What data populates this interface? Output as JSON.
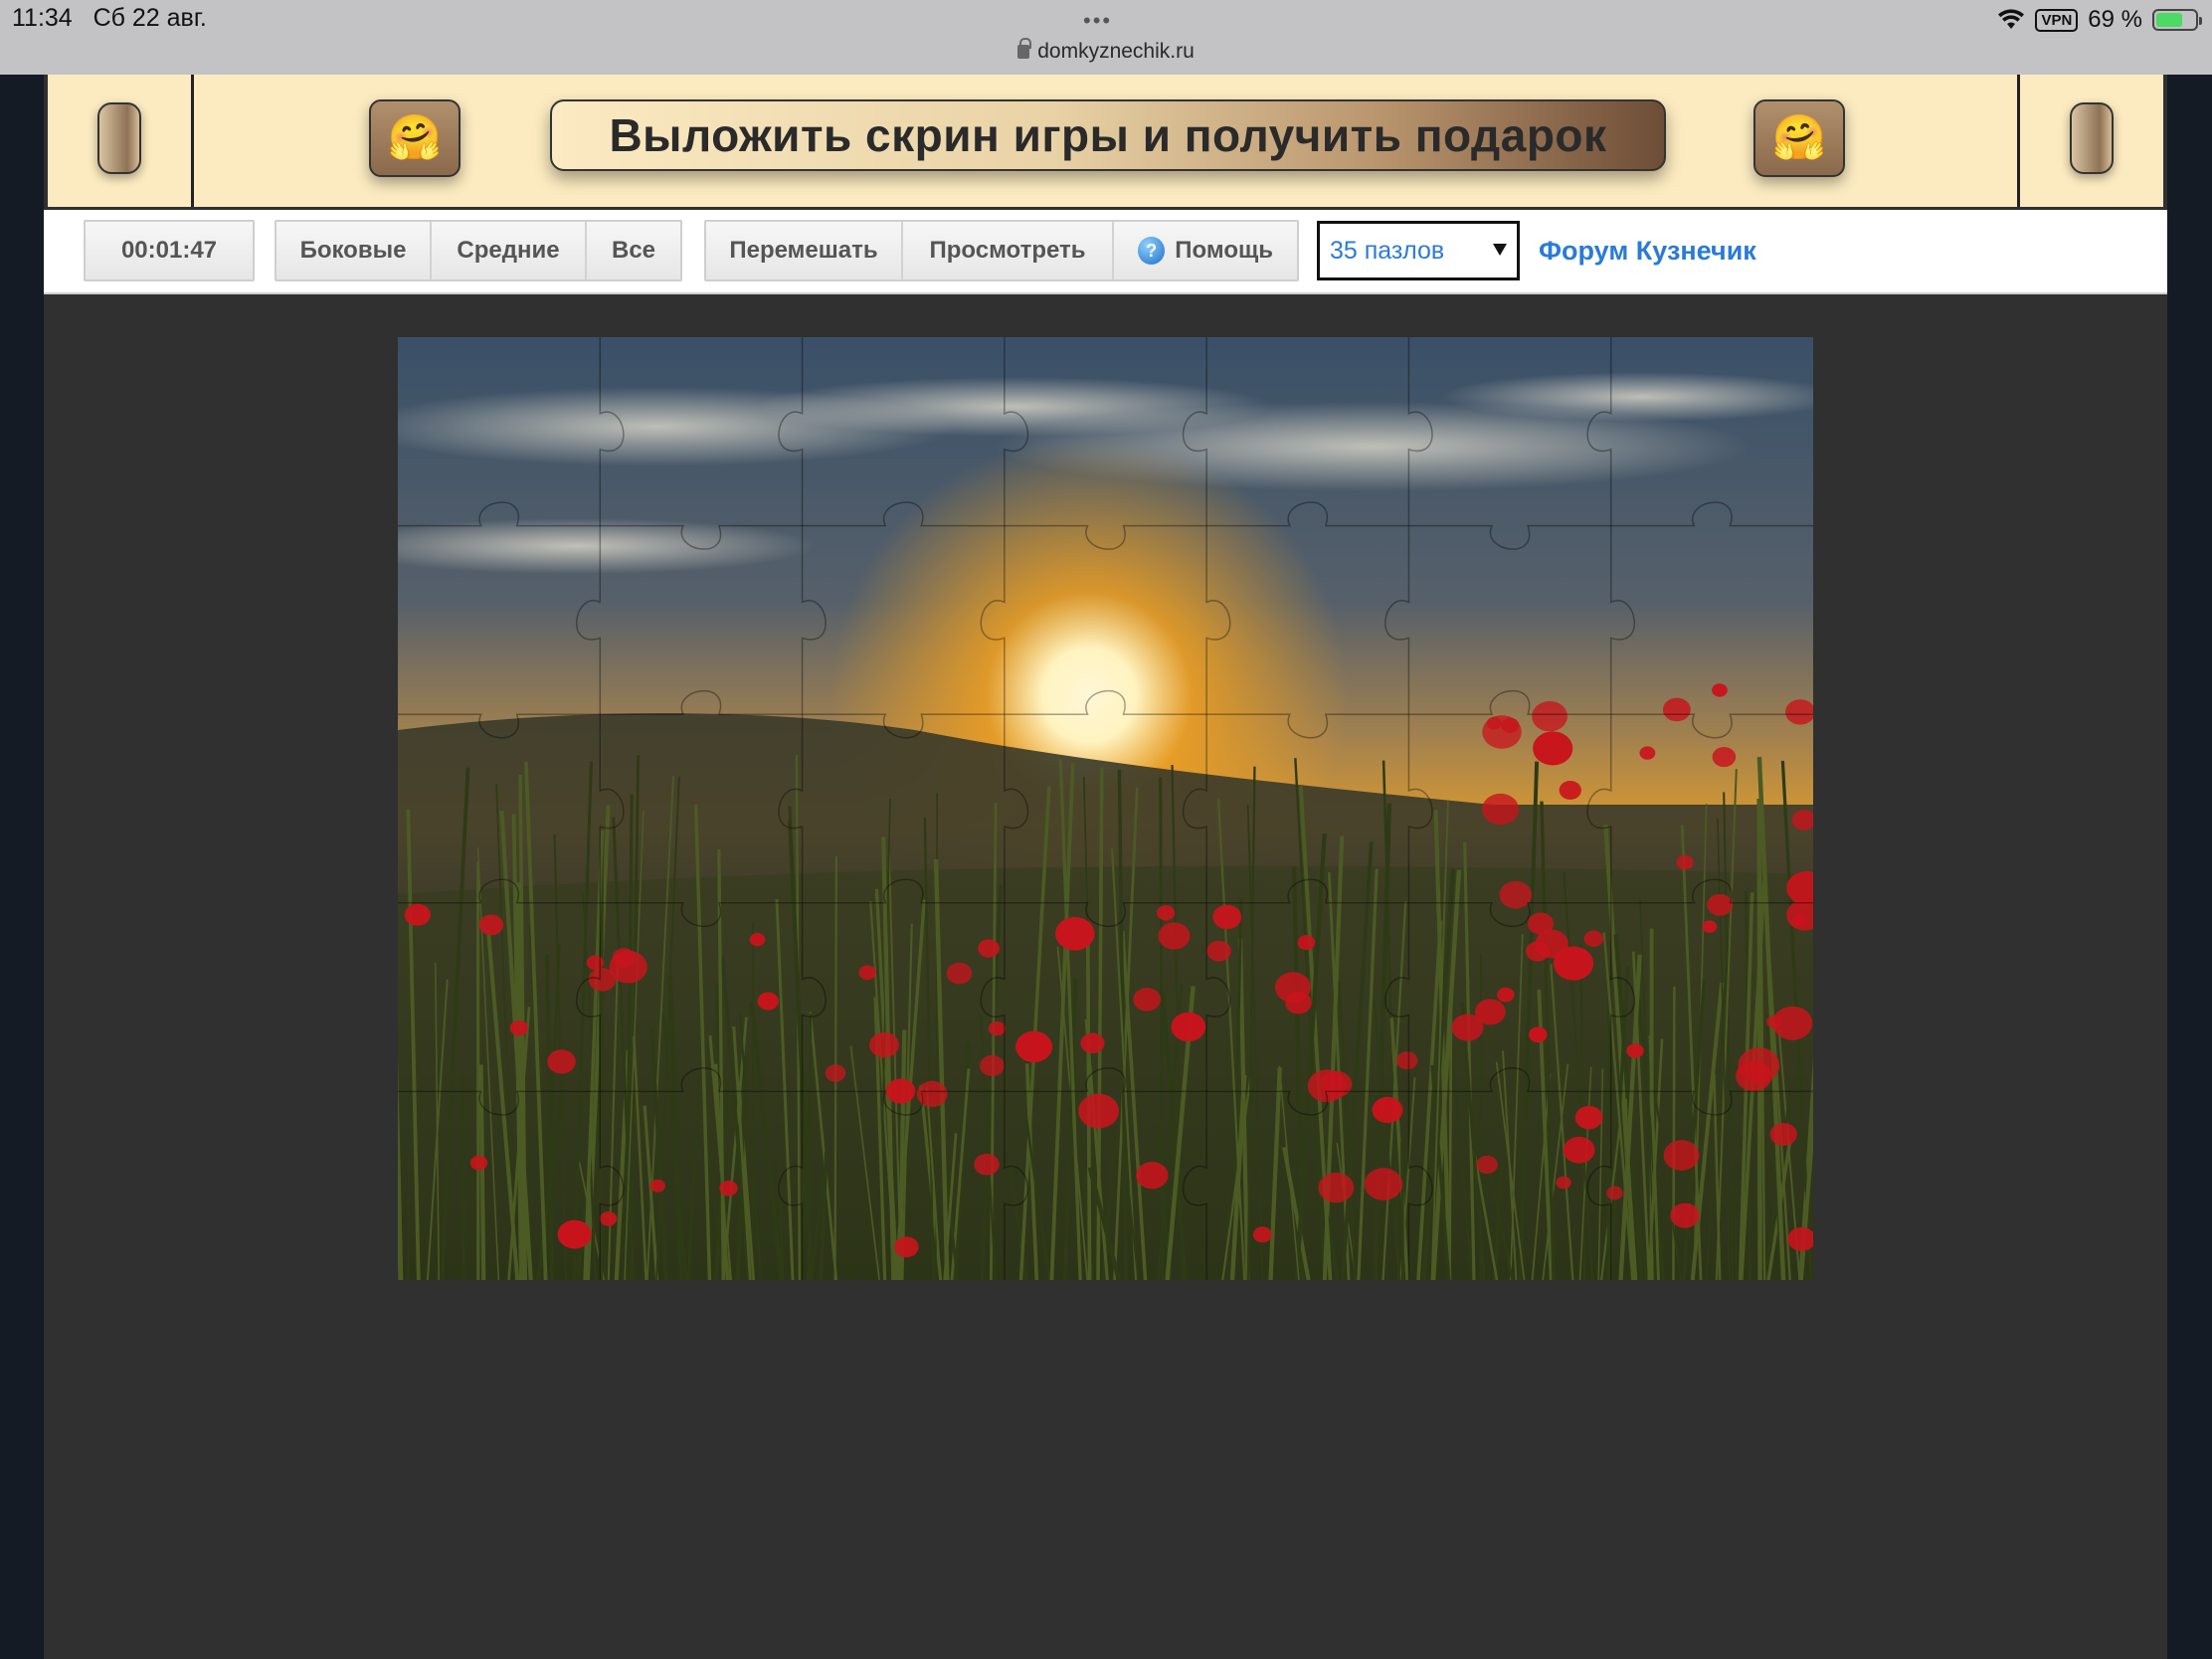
{
  "status_bar": {
    "time": "11:34",
    "date": "Сб 22 авг.",
    "url": "domkyznechik.ru",
    "vpn": "VPN",
    "battery": "69 %",
    "battery_level": 0.69
  },
  "banner": {
    "title": "Выложить скрин игры и получить подарок",
    "emoji": "🤗"
  },
  "toolbar": {
    "timer": "00:01:47",
    "filter_buttons": [
      "Боковые",
      "Средние",
      "Все"
    ],
    "action_buttons": {
      "shuffle": "Перемешать",
      "preview": "Просмотреть",
      "help": "Помощь",
      "help_icon": "?"
    },
    "select_value": "35 пазлов",
    "forum_link": "Форум Кузнечик"
  },
  "puzzle": {
    "grid": "7x5",
    "pieces": 35,
    "image_subject": "sunset over field of red poppies",
    "colors": {
      "sky_top": "#3a5068",
      "sun": "#fff6d6",
      "glow": "#f0a020",
      "hill": "#3a3a2a",
      "grass": "#2c3418",
      "poppy": "#c8141c"
    }
  },
  "colors": {
    "banner_bg": "#fcebc0",
    "link": "#2b7bd6",
    "page_bg": "#303030"
  }
}
